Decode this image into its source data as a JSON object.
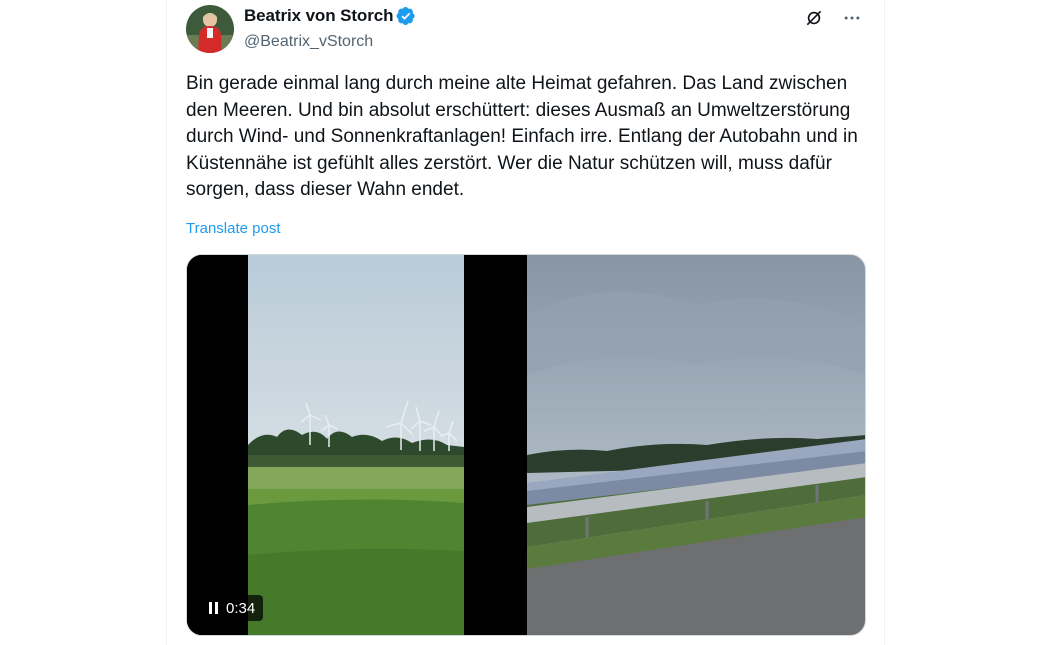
{
  "author": {
    "name": "Beatrix von Storch",
    "handle": "@Beatrix_vStorch",
    "verified": true,
    "verified_color": "#1d9bf0"
  },
  "actions": {
    "grok_icon": "grok-icon",
    "more_icon": "more-icon"
  },
  "post": {
    "text": "Bin gerade einmal lang durch meine alte Heimat gefahren. Das Land zwischen den Meeren. Und bin absolut erschüttert: dieses Ausmaß an Umweltzerstörung durch Wind- und Sonnenkraftanlagen! Einfach irre. Entlang der Autobahn und in Küstennähe ist gefühlt alles zerstört. Wer die Natur schützen will, muss dafür sorgen, dass dieser Wahn endet.",
    "translate_label": "Translate post"
  },
  "media": {
    "video_time": "0:34",
    "left_image": "wind-turbines-meadow",
    "right_image": "solar-park-highway"
  },
  "colors": {
    "link": "#1d9bf0",
    "secondary_text": "#536471"
  }
}
